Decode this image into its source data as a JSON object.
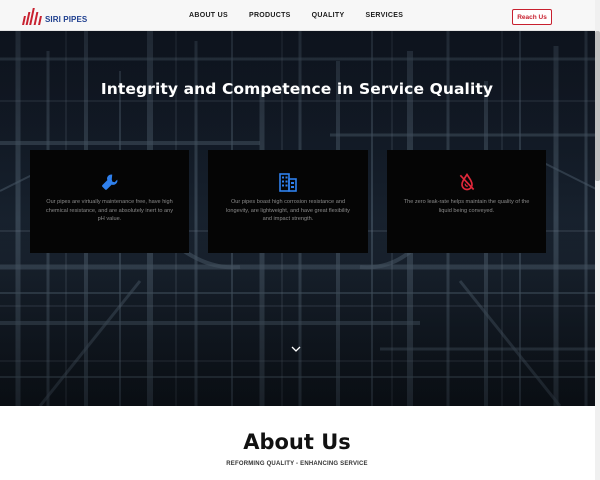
{
  "header": {
    "logo_text": "SIRI PIPES",
    "nav": [
      "ABOUT US",
      "PRODUCTS",
      "QUALITY",
      "SERVICES"
    ],
    "cta_label": "Reach Us"
  },
  "hero": {
    "title": "Integrity and Competence in Service Quality",
    "cards": [
      {
        "icon": "wrench-icon",
        "icon_color": "#2f80ed",
        "text": "Our pipes are virtually maintenance free, have high chemical resistance, and are absolutely inert to any pH value."
      },
      {
        "icon": "building-icon",
        "icon_color": "#2f80ed",
        "text": "Our pipes boast high corrosion resistance and longevity, are lightweight, and have great flexibility and impact strength."
      },
      {
        "icon": "no-leak-drop-icon",
        "icon_color": "#e0283b",
        "text": "The zero leak-rate helps maintain the quality of the liquid being conveyed."
      }
    ],
    "scroll_icon": "chevron-down-icon"
  },
  "about": {
    "title": "About Us",
    "subtitle": "REFORMING QUALITY - ENHANCING SERVICE"
  },
  "colors": {
    "brand_red": "#c8202f",
    "brand_blue": "#1f3f8f",
    "card_bg": "#050505"
  }
}
